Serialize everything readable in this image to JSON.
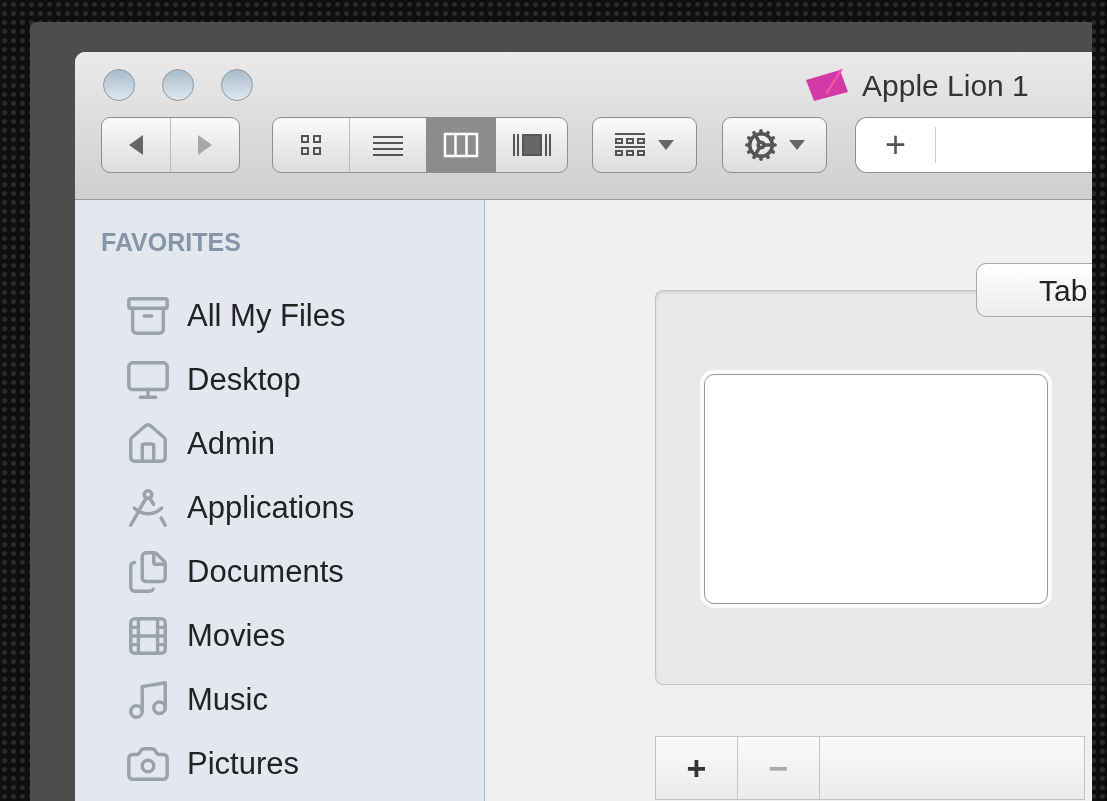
{
  "window": {
    "title": "Apple Lion 1"
  },
  "toolbar": {
    "navigation": [
      {
        "kind": "back",
        "disabled": false
      },
      {
        "kind": "forward",
        "disabled": true
      }
    ],
    "views": [
      {
        "kind": "icons",
        "selected": false
      },
      {
        "kind": "list",
        "selected": false
      },
      {
        "kind": "columns",
        "selected": true
      },
      {
        "kind": "coverflow",
        "selected": false
      }
    ],
    "path_field": {
      "add_label": "+"
    }
  },
  "sidebar": {
    "heading": "FAVORITES",
    "items": [
      {
        "label": "All My Files"
      },
      {
        "label": "Desktop"
      },
      {
        "label": "Admin"
      },
      {
        "label": "Applications"
      },
      {
        "label": "Documents"
      },
      {
        "label": "Movies"
      },
      {
        "label": "Music"
      },
      {
        "label": "Pictures"
      }
    ]
  },
  "content": {
    "tab": {
      "label": "Tab"
    },
    "bottom_bar": {
      "buttons": [
        "+",
        "−"
      ]
    }
  }
}
